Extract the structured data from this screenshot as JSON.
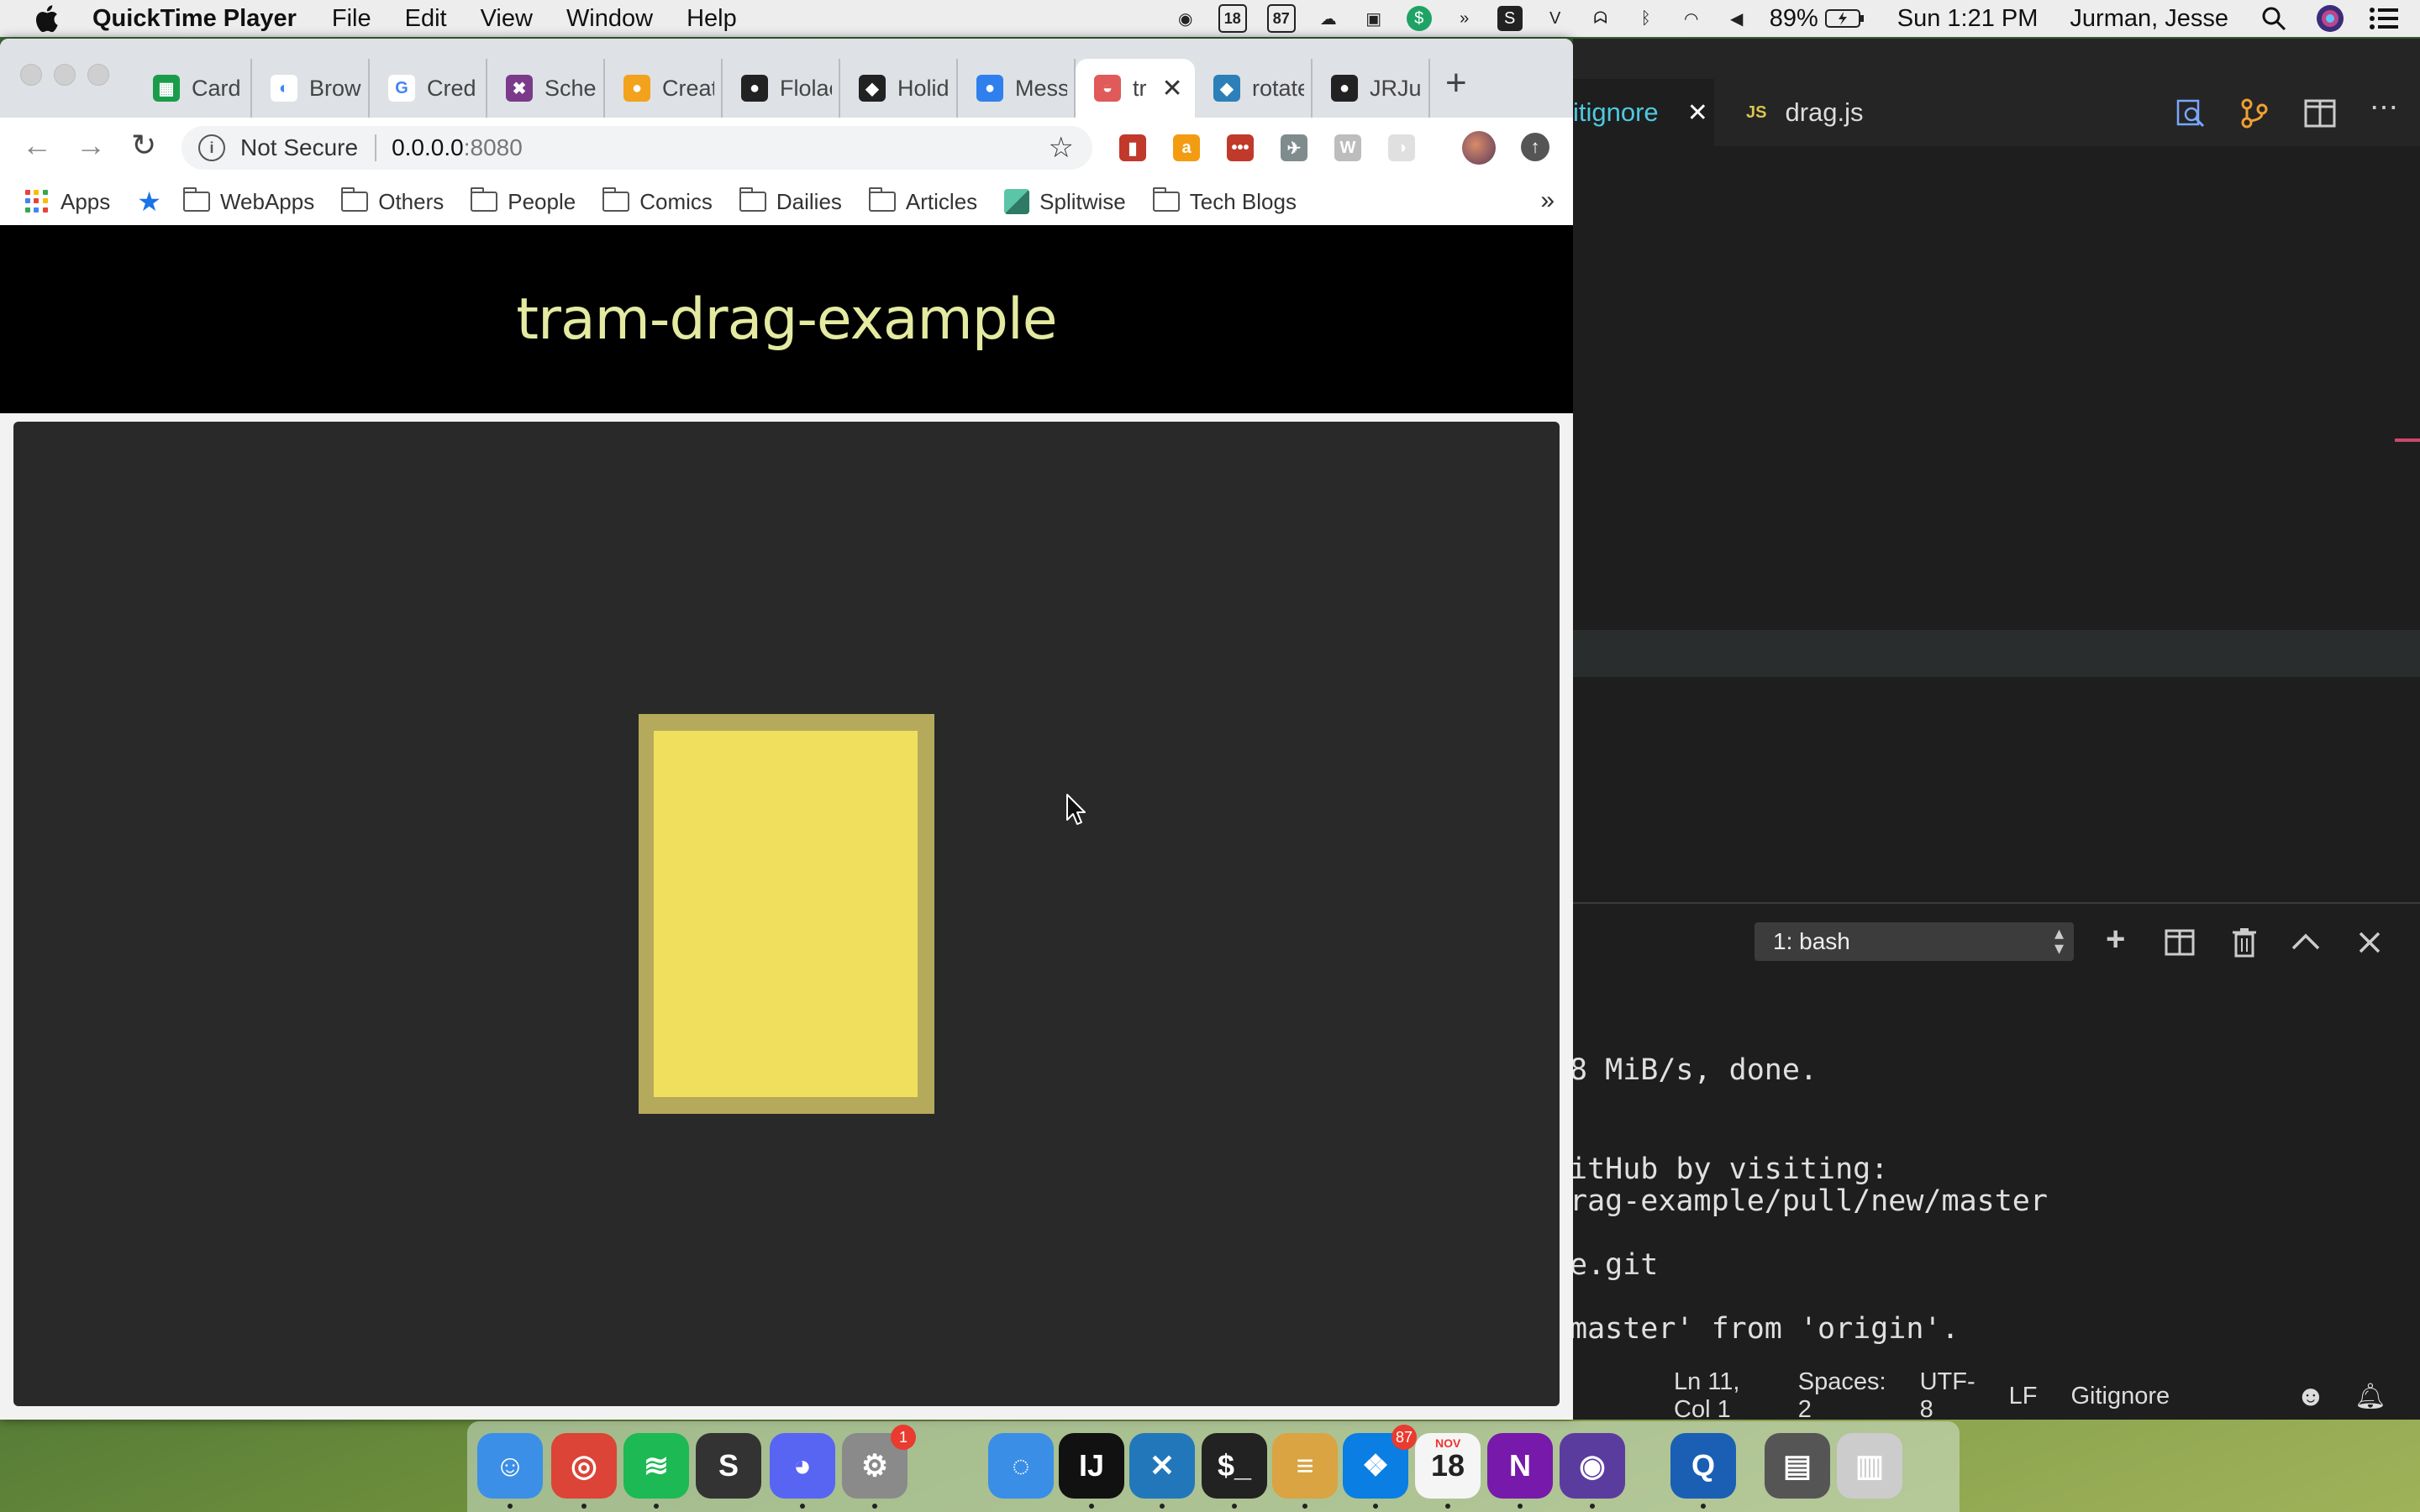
{
  "menubar": {
    "app_name": "QuickTime Player",
    "menus": [
      "File",
      "Edit",
      "View",
      "Window",
      "Help"
    ],
    "status_icons": [
      {
        "name": "record-icon",
        "glyph": "◉"
      },
      {
        "name": "calendar-18-icon",
        "glyph": "18"
      },
      {
        "name": "counter-87-icon",
        "glyph": "87"
      },
      {
        "name": "cloud-icon",
        "glyph": "☁"
      },
      {
        "name": "screen-icon",
        "glyph": "▣"
      },
      {
        "name": "dollar-icon",
        "glyph": "$"
      },
      {
        "name": "arrows-icon",
        "glyph": "»"
      },
      {
        "name": "s-icon",
        "glyph": "S"
      },
      {
        "name": "vs-icon",
        "glyph": "V"
      },
      {
        "name": "ghost-icon",
        "glyph": "ᗣ"
      },
      {
        "name": "bluetooth-icon",
        "glyph": "ᛒ"
      },
      {
        "name": "wifi-icon",
        "glyph": "◠"
      },
      {
        "name": "volume-icon",
        "glyph": "◀"
      }
    ],
    "battery": "89%",
    "clock": "Sun 1:21 PM",
    "user": "Jurman, Jesse"
  },
  "chrome": {
    "tabs": [
      {
        "label": "Card",
        "color": "#1a9c4a",
        "glyph": "▦"
      },
      {
        "label": "Brow",
        "color": "#ffffff",
        "glyph": "◐"
      },
      {
        "label": "Cred",
        "color": "#ffffff",
        "glyph": "G"
      },
      {
        "label": "Sche",
        "color": "#7b3a8a",
        "glyph": "✖"
      },
      {
        "label": "Creat",
        "color": "#f3a21b",
        "glyph": "●"
      },
      {
        "label": "Flolac",
        "color": "#222222",
        "glyph": "●"
      },
      {
        "label": "Holid",
        "color": "#222222",
        "glyph": "◆"
      },
      {
        "label": "Mess",
        "color": "#2f80ed",
        "glyph": "●"
      },
      {
        "label": "tr",
        "color": "#e05a5a",
        "glyph": "◒"
      },
      {
        "label": "rotate",
        "color": "#2c7fb8",
        "glyph": "◆"
      },
      {
        "label": "JRJur",
        "color": "#222222",
        "glyph": "●"
      }
    ],
    "active_tab_index": 8,
    "security_label": "Not Secure",
    "url_host": "0.0.0.0",
    "url_port": ":8080",
    "extensions": [
      {
        "name": "book-extension-icon",
        "color": "#c0392b",
        "glyph": "▮"
      },
      {
        "name": "amazon-extension-icon",
        "color": "#f39c12",
        "glyph": "a"
      },
      {
        "name": "lastpass-extension-icon",
        "color": "#c0392b",
        "glyph": "•••"
      },
      {
        "name": "wing-extension-icon",
        "color": "#7f8c8d",
        "glyph": "✈"
      },
      {
        "name": "w-extension-icon",
        "color": "#bdbdbd",
        "glyph": "W"
      },
      {
        "name": "gray-extension-icon",
        "color": "#e0e0e0",
        "glyph": "◑"
      }
    ],
    "bookmarks": [
      "Apps",
      "WebApps",
      "Others",
      "People",
      "Comics",
      "Dailies",
      "Articles",
      "Splitwise",
      "Tech Blogs"
    ],
    "more_glyph": "»"
  },
  "page": {
    "title": "tram-drag-example",
    "card_color": "#efdf5c",
    "card_border_color": "#b5a95c"
  },
  "vscode": {
    "tab_gitignore": "itignore",
    "tab_drag": "drag.js",
    "tab_drag_badge": "JS",
    "terminal_selector": "1: bash",
    "terminal_lines": [
      "8 MiB/s, done.",
      "",
      "itHub by visiting:",
      "rag-example/pull/new/master",
      "",
      "e.git",
      "",
      "master' from 'origin'."
    ],
    "status": {
      "position": "Ln 11, Col 1",
      "spaces": "Spaces: 2",
      "encoding": "UTF-8",
      "eol": "LF",
      "language": "Gitignore"
    }
  },
  "dock": {
    "apps": [
      {
        "name": "finder",
        "color": "#3b8fe6",
        "glyph": "☺"
      },
      {
        "name": "chrome",
        "color": "#db4437",
        "glyph": "◎"
      },
      {
        "name": "spotify",
        "color": "#1db954",
        "glyph": "≋"
      },
      {
        "name": "slides",
        "color": "#333333",
        "glyph": "S"
      },
      {
        "name": "discord",
        "color": "#5865f2",
        "glyph": "◕"
      },
      {
        "name": "system-preferences",
        "color": "#8a8a8a",
        "glyph": "⚙"
      },
      {
        "name": "messages",
        "color": "#3a8ee6",
        "glyph": "◌"
      },
      {
        "name": "intellij",
        "color": "#111111",
        "glyph": "IJ"
      },
      {
        "name": "vscode",
        "color": "#2277bb",
        "glyph": "✕"
      },
      {
        "name": "terminal",
        "color": "#222222",
        "glyph": "$_"
      },
      {
        "name": "sequel",
        "color": "#d9a441",
        "glyph": "≡"
      },
      {
        "name": "dropbox",
        "color": "#0a7ee2",
        "glyph": "❖"
      },
      {
        "name": "calendar",
        "color": "#f5f5f5",
        "glyph": "18"
      },
      {
        "name": "onenote",
        "color": "#7719aa",
        "glyph": "N"
      },
      {
        "name": "siri",
        "color": "#5a3c9e",
        "glyph": "◉"
      },
      {
        "name": "quicktime",
        "color": "#1a5fb4",
        "glyph": "Q"
      },
      {
        "name": "printer",
        "color": "#555555",
        "glyph": "▤"
      },
      {
        "name": "trash",
        "color": "#cccccc",
        "glyph": "▥"
      }
    ],
    "badges": {
      "system-preferences": "1",
      "dropbox": "87"
    },
    "calendar_month": "NOV"
  }
}
